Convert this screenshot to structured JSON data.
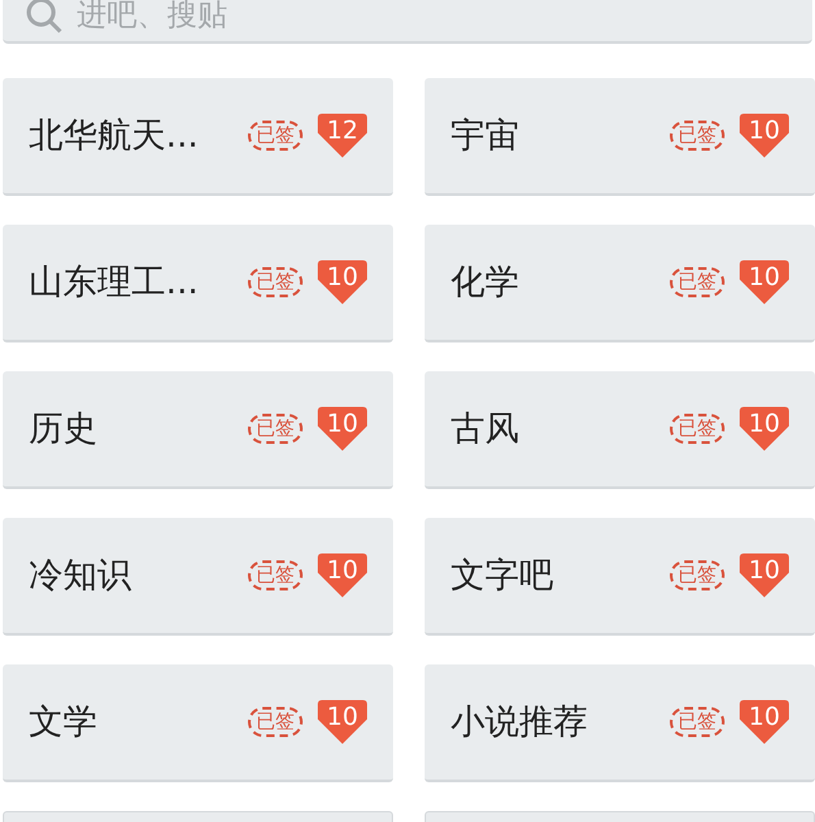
{
  "search": {
    "placeholder": "进吧、搜贴"
  },
  "forums": [
    {
      "name": "北华航天...",
      "signed": true,
      "sign_label": "已签",
      "level": "12"
    },
    {
      "name": "宇宙",
      "signed": true,
      "sign_label": "已签",
      "level": "10"
    },
    {
      "name": "山东理工...",
      "signed": true,
      "sign_label": "已签",
      "level": "10"
    },
    {
      "name": "化学",
      "signed": true,
      "sign_label": "已签",
      "level": "10"
    },
    {
      "name": "历史",
      "signed": true,
      "sign_label": "已签",
      "level": "10"
    },
    {
      "name": "古风",
      "signed": true,
      "sign_label": "已签",
      "level": "10"
    },
    {
      "name": "冷知识",
      "signed": true,
      "sign_label": "已签",
      "level": "10"
    },
    {
      "name": "文字吧",
      "signed": true,
      "sign_label": "已签",
      "level": "10"
    },
    {
      "name": "文学",
      "signed": true,
      "sign_label": "已签",
      "level": "10"
    },
    {
      "name": "小说推荐",
      "signed": true,
      "sign_label": "已签",
      "level": "10"
    }
  ]
}
